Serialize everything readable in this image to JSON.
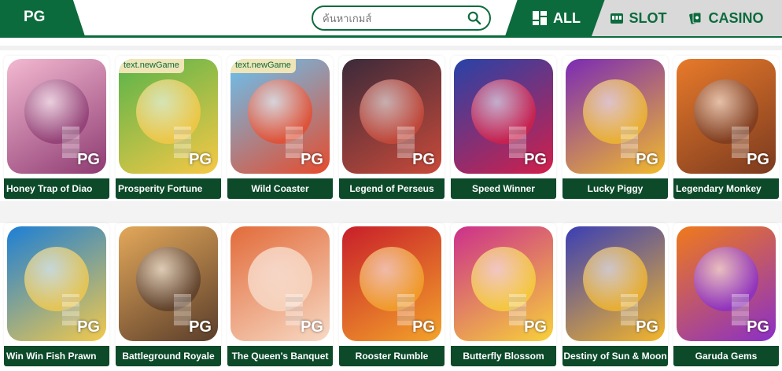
{
  "header": {
    "brand": "PG",
    "search_placeholder": "ค้นหาเกมส์",
    "tabs": [
      {
        "label": "ALL",
        "icon": "grid-icon",
        "active": true
      },
      {
        "label": "SLOT",
        "icon": "slot-machine-icon",
        "active": false
      },
      {
        "label": "CASINO",
        "icon": "cards-icon",
        "active": false
      }
    ]
  },
  "colors": {
    "brand_green": "#0c6b3d",
    "label_bg": "#0c4a2a",
    "tab_inactive": "#d9d9d9"
  },
  "games": [
    {
      "title": "Honey Trap of Diao",
      "tag": "",
      "provider": "PG",
      "color_a": "#f3b9d1",
      "color_b": "#8e3b72"
    },
    {
      "title": "Prosperity Fortune",
      "tag": "text.newGame",
      "provider": "PG",
      "color_a": "#57b44a",
      "color_b": "#f7c846"
    },
    {
      "title": "Wild Coaster",
      "tag": "text.newGame",
      "provider": "PG",
      "color_a": "#67c3f3",
      "color_b": "#e64b2c"
    },
    {
      "title": "Legend of Perseus",
      "tag": "",
      "provider": "PG",
      "color_a": "#3b2a3a",
      "color_b": "#c94a3a"
    },
    {
      "title": "Speed Winner",
      "tag": "",
      "provider": "PG",
      "color_a": "#2743a8",
      "color_b": "#d21f4a"
    },
    {
      "title": "Lucky Piggy",
      "tag": "",
      "provider": "PG",
      "color_a": "#7b2bb5",
      "color_b": "#f1b92c"
    },
    {
      "title": "Legendary Monkey",
      "tag": "",
      "provider": "PG",
      "color_a": "#e87a2a",
      "color_b": "#7b3a1f"
    },
    {
      "title": "Win Win Fish Prawn",
      "tag": "",
      "provider": "PG",
      "color_a": "#1c7fd6",
      "color_b": "#f2c94c"
    },
    {
      "title": "Battleground Royale",
      "tag": "",
      "provider": "PG",
      "color_a": "#e3a85a",
      "color_b": "#5a3d2a"
    },
    {
      "title": "The Queen's Banquet",
      "tag": "",
      "provider": "PG",
      "color_a": "#e26b3a",
      "color_b": "#f7d9c4"
    },
    {
      "title": "Rooster Rumble",
      "tag": "",
      "provider": "PG",
      "color_a": "#c81e2a",
      "color_b": "#f3a32a"
    },
    {
      "title": "Butterfly Blossom",
      "tag": "",
      "provider": "PG",
      "color_a": "#cc2f8c",
      "color_b": "#f7d23a"
    },
    {
      "title": "Destiny of Sun & Moon",
      "tag": "",
      "provider": "PG",
      "color_a": "#3a3fb5",
      "color_b": "#f3b62a"
    },
    {
      "title": "Garuda Gems",
      "tag": "",
      "provider": "PG",
      "color_a": "#f07a1a",
      "color_b": "#8a2fc8"
    }
  ]
}
